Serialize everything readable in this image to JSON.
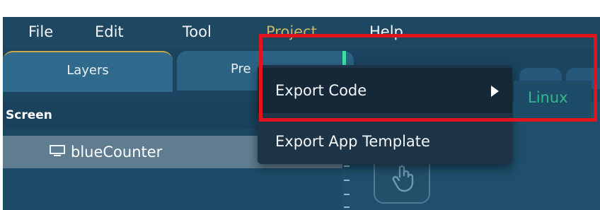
{
  "menubar": {
    "items": [
      "File",
      "Edit",
      "Tool",
      "Project",
      "Help"
    ],
    "active": "Project"
  },
  "tabs": [
    "Layers",
    "Pre"
  ],
  "panel": {
    "header": "Screen",
    "layer_name": "blueCounter"
  },
  "dropdown": {
    "items": [
      "Export Code",
      "Export App Template"
    ],
    "submenu": [
      "Linux"
    ]
  },
  "icons": {
    "layer_icon": "monitor-icon",
    "submenu_indicator": "triangle-right-icon",
    "widget_icon": "touch-hand-icon"
  },
  "colors": {
    "background": "#1f4a66",
    "menu_active": "#c9b56a",
    "highlight_border": "#e0141c",
    "submenu_text": "#34b88a",
    "selection_marker": "#3ee0a0"
  }
}
